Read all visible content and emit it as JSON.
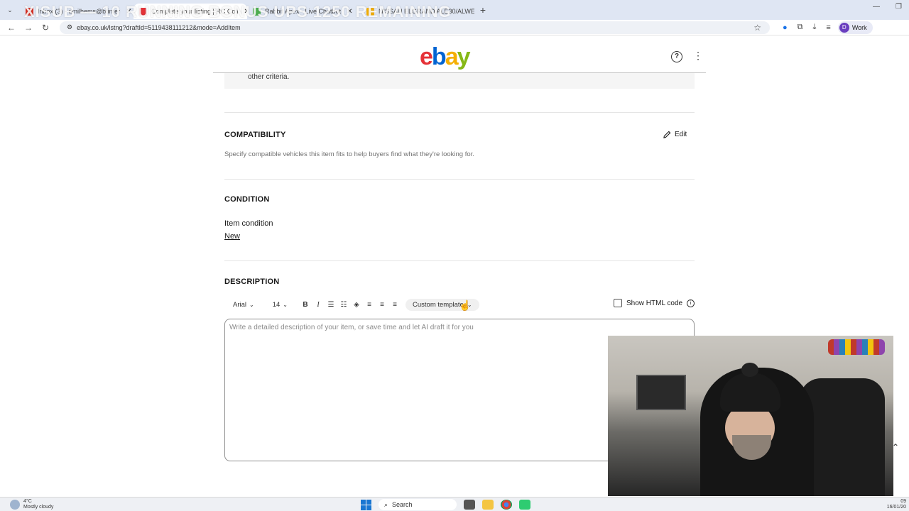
{
  "browser": {
    "tabs": [
      {
        "title": "Inbox (3) - dmilhems@btinter",
        "favicon_color": "#d93025"
      },
      {
        "title": "Complete your listing | RC Coil",
        "favicon_color": "#e53238",
        "active": true
      },
      {
        "title": "Rabbit Apex - Live Chatbot",
        "favicon_color": "#4caf50"
      },
      {
        "title": "NISSAN ELGRAND ALE30/ALWE",
        "favicon_color": "#f5af02"
      }
    ],
    "overlay_text": "XISUB — 10 RUNNING BONUS UPS 1250 REMAINING",
    "url": "ebay.co.uk/lstng?draftId=5119438111212&mode=AddItem",
    "profile_initial": "D",
    "profile_label": "Work"
  },
  "ebay": {
    "logo": {
      "e": "e",
      "b": "b",
      "a": "a",
      "y": "y"
    },
    "help_label": "?",
    "menu_label": "⋮"
  },
  "top_box_text": "other criteria.",
  "compatibility": {
    "title": "COMPATIBILITY",
    "edit_label": "Edit",
    "description": "Specify compatible vehicles this item fits to help buyers find what they're looking for."
  },
  "condition": {
    "title": "CONDITION",
    "label": "Item condition",
    "value": "New"
  },
  "description": {
    "title": "DESCRIPTION",
    "font": "Arial",
    "font_size": "14",
    "template_label": "Custom template",
    "show_html_label": "Show HTML code",
    "placeholder": "Write a detailed description of your item, or save time and let AI draft it for you"
  },
  "taskbar": {
    "temperature": "4°C",
    "weather": "Mostly cloudy",
    "search_label": "Search",
    "time": "09",
    "date": "16/01/20"
  }
}
